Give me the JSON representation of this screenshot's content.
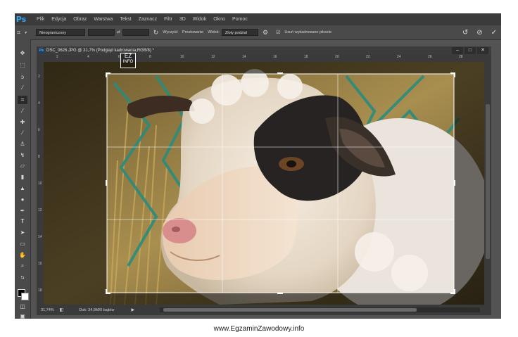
{
  "app": {
    "logo": "Ps",
    "menu": [
      "Plik",
      "Edycja",
      "Obraz",
      "Warstwa",
      "Tekst",
      "Zaznacz",
      "Filtr",
      "3D",
      "Widok",
      "Okno",
      "Pomoc"
    ]
  },
  "options": {
    "ratio": "Nieograniczony",
    "clear": "Wyczyść",
    "straighten": "Prostowanie",
    "view_label": "Widok:",
    "view_value": "Zloty podzial",
    "delete_pixels": "Usuń wykadrowane piksele"
  },
  "document": {
    "tab_title": "DSC_0626.JPG @ 31,7% (Podgląd kadrowania,RGB/8) *",
    "ruler_top": [
      "2",
      "4",
      "6",
      "8",
      "10",
      "12",
      "14",
      "16",
      "18",
      "20",
      "22",
      "24",
      "26",
      "28"
    ],
    "ruler_left": [
      "2",
      "4",
      "6",
      "8",
      "10",
      "12",
      "14",
      "16",
      "18"
    ],
    "zoom": "31,74%",
    "doc_info": "Dok: 34,9M/0 bajtów"
  },
  "watermark": {
    "overlay_text_1": "EZ",
    "overlay_text_2": "INFO",
    "url": "www.EgzaminZawodowy.info"
  },
  "colors": {
    "accent": "#33a3f4",
    "app_bg": "#535353",
    "fence": "#2a8c7c"
  },
  "icons": [
    "crop-icon",
    "rotate-icon",
    "settings-icon",
    "reset-icon",
    "cancel-icon",
    "commit-icon",
    "move-icon",
    "marquee-icon",
    "lasso-icon",
    "magic-wand-icon",
    "eyedropper-icon",
    "brush-icon",
    "hand-icon",
    "zoom-icon"
  ]
}
